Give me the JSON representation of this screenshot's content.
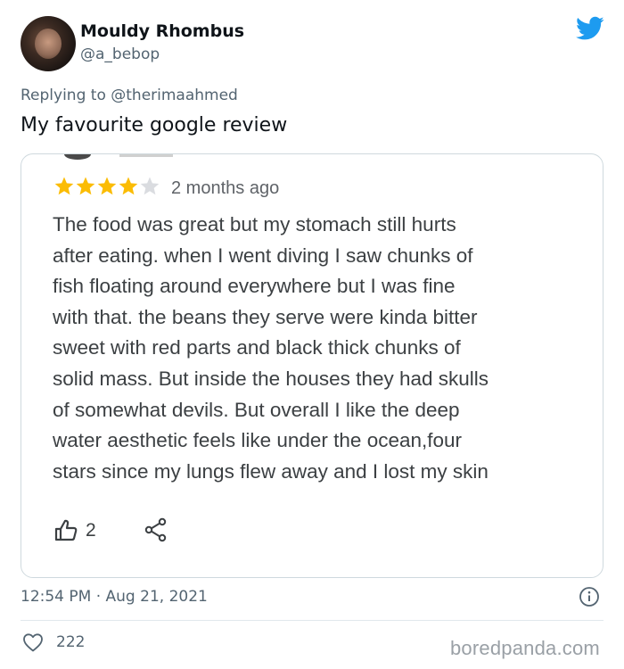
{
  "tweet": {
    "author_name": "Mouldy Rhombus",
    "author_handle": "@a_bebop",
    "replying_prefix": "Replying to",
    "replying_to": "@therimaahmed",
    "text": "My favourite google review",
    "timestamp": "12:54 PM · Aug 21, 2021",
    "like_count": "222"
  },
  "review": {
    "rating": 4,
    "max_rating": 5,
    "age": "2 months ago",
    "body": "The food was great but my stomach still hurts\nafter eating. when I went diving I saw chunks of\nfish floating around everywhere but I was fine\nwith that. the beans they serve were kinda bitter\nsweet with red parts and black thick chunks of\nsolid mass. But inside the houses they had skulls\nof somewhat devils. But overall I like the deep\nwater aesthetic feels like under the ocean,four\nstars since my lungs flew away and I lost my skin",
    "helpful_count": "2"
  },
  "colors": {
    "star_filled": "#fbbc04",
    "star_empty": "#dadce0",
    "twitter_blue": "#1d9bf0",
    "secondary_text": "#536471"
  },
  "icons": {
    "logo": "twitter-bird-icon",
    "helpful": "thumbs-up-icon",
    "share": "share-icon",
    "info": "info-icon",
    "like": "heart-icon"
  },
  "watermark": "boredpanda.com"
}
